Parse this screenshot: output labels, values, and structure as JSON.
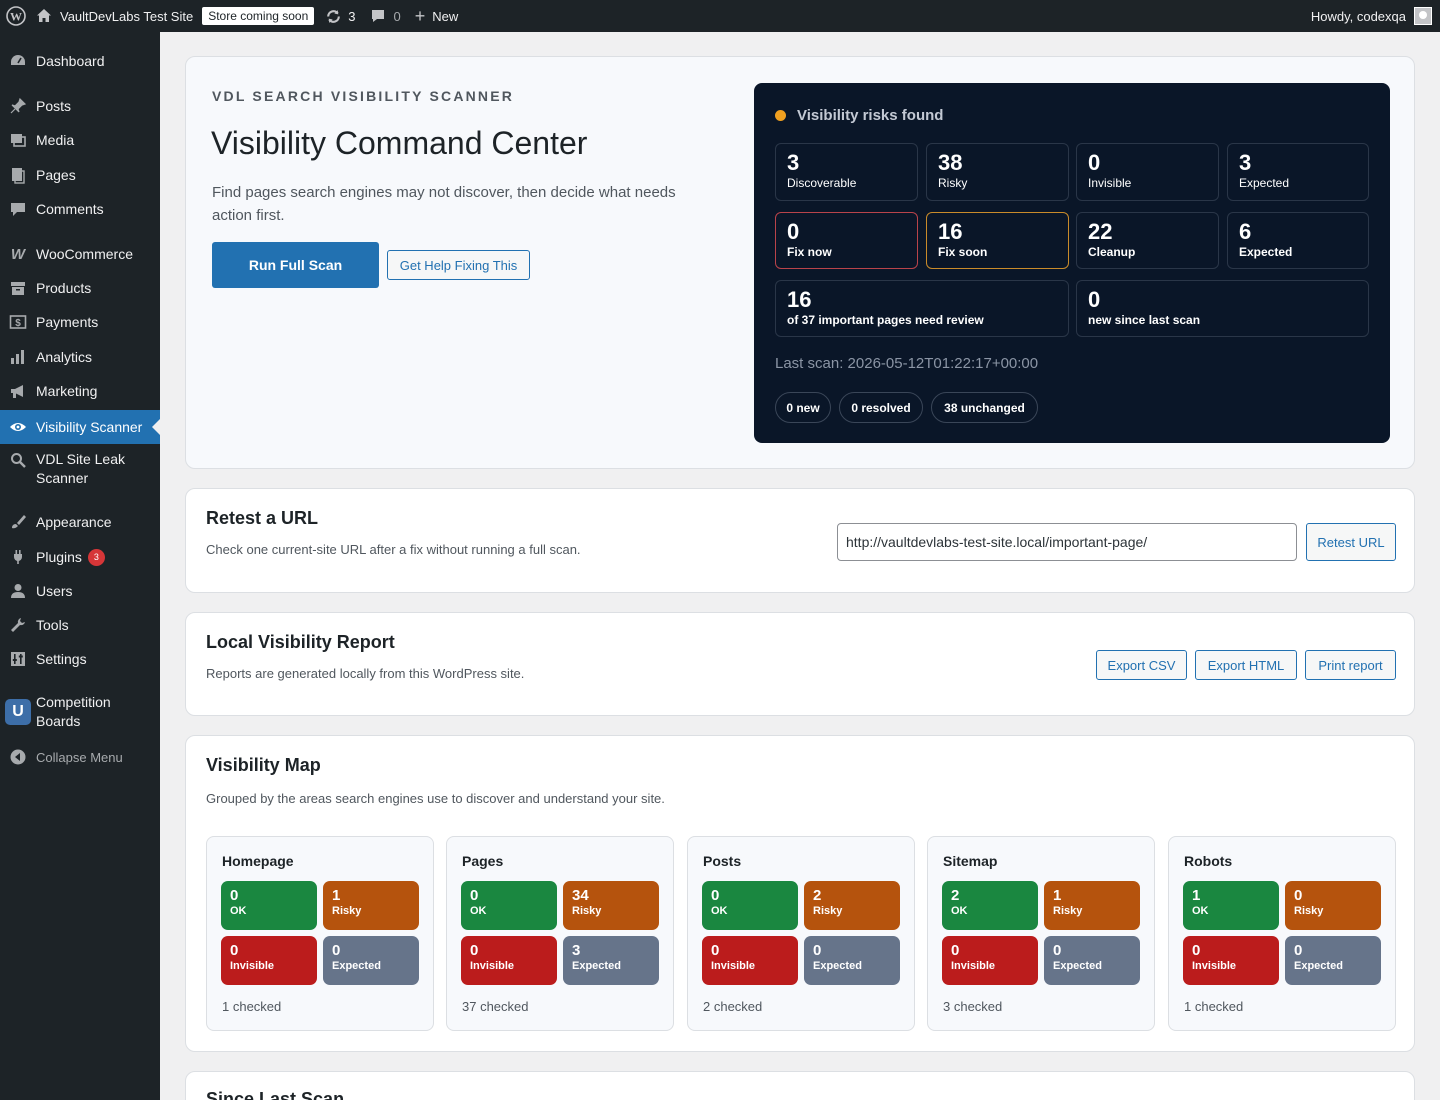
{
  "adminbar": {
    "site_name": "VaultDevLabs Test Site",
    "store_badge": "Store coming soon",
    "updates_count": "3",
    "comments_count": "0",
    "new_label": "New",
    "howdy": "Howdy, codexqa"
  },
  "sidebar": {
    "items": [
      {
        "label": "Dashboard",
        "icon": "dashboard-icon"
      },
      {
        "label": "Posts",
        "icon": "pin-icon"
      },
      {
        "label": "Media",
        "icon": "media-icon"
      },
      {
        "label": "Pages",
        "icon": "page-icon"
      },
      {
        "label": "Comments",
        "icon": "comment-icon"
      },
      {
        "label": "WooCommerce",
        "icon": "woo-icon"
      },
      {
        "label": "Products",
        "icon": "archive-icon"
      },
      {
        "label": "Payments",
        "icon": "dollar-icon"
      },
      {
        "label": "Analytics",
        "icon": "bar-chart-icon"
      },
      {
        "label": "Marketing",
        "icon": "megaphone-icon"
      },
      {
        "label": "Visibility Scanner",
        "icon": "eye-icon"
      },
      {
        "label": "VDL Site Leak Scanner",
        "icon": "search-icon"
      },
      {
        "label": "Appearance",
        "icon": "brush-icon"
      },
      {
        "label": "Plugins",
        "icon": "plug-icon",
        "badge": "3"
      },
      {
        "label": "Users",
        "icon": "user-icon"
      },
      {
        "label": "Tools",
        "icon": "wrench-icon"
      },
      {
        "label": "Settings",
        "icon": "sliders-icon"
      },
      {
        "label": "Competition Boards",
        "icon": "magnet-icon"
      }
    ],
    "collapse_label": "Collapse Menu",
    "active_color": "#2271b1"
  },
  "hero": {
    "eyebrow": "VDL SEARCH VISIBILITY SCANNER",
    "title": "Visibility Command Center",
    "description": "Find pages search engines may not discover, then decide what needs action first.",
    "run_button": "Run Full Scan",
    "help_button": "Get Help Fixing This"
  },
  "panel": {
    "heading": "Visibility risks found",
    "status_color": "#f0a020",
    "row1": [
      {
        "value": "3",
        "label": "Discoverable"
      },
      {
        "value": "38",
        "label": "Risky"
      },
      {
        "value": "0",
        "label": "Invisible"
      },
      {
        "value": "3",
        "label": "Expected"
      }
    ],
    "row2": [
      {
        "value": "0",
        "label": "Fix now"
      },
      {
        "value": "16",
        "label": "Fix soon"
      },
      {
        "value": "22",
        "label": "Cleanup"
      },
      {
        "value": "6",
        "label": "Expected"
      }
    ],
    "row3": [
      {
        "value": "16",
        "label": "of 37 important pages need review"
      },
      {
        "value": "0",
        "label": "new since last scan"
      }
    ],
    "last_scan": "Last scan: 2026-05-12T01:22:17+00:00",
    "pills": [
      "0 new",
      "0 resolved",
      "38 unchanged"
    ]
  },
  "retest": {
    "title": "Retest a URL",
    "description": "Check one current-site URL after a fix without running a full scan.",
    "url_value": "http://vaultdevlabs-test-site.local/important-page/",
    "button": "Retest URL"
  },
  "report": {
    "title": "Local Visibility Report",
    "description": "Reports are generated locally from this WordPress site.",
    "buttons": [
      "Export CSV",
      "Export HTML",
      "Print report"
    ]
  },
  "map": {
    "title": "Visibility Map",
    "description": "Grouped by the areas search engines use to discover and understand your site.",
    "tile_labels": {
      "ok": "OK",
      "risky": "Risky",
      "invisible": "Invisible",
      "expected": "Expected"
    },
    "colors": {
      "ok": "#1a8740",
      "risky": "#b5530d",
      "invisible": "#bb1c1c",
      "expected": "#66748a"
    },
    "groups": [
      {
        "name": "Homepage",
        "ok": "0",
        "risky": "1",
        "invisible": "0",
        "expected": "0",
        "checked": "1 checked"
      },
      {
        "name": "Pages",
        "ok": "0",
        "risky": "34",
        "invisible": "0",
        "expected": "3",
        "checked": "37 checked"
      },
      {
        "name": "Posts",
        "ok": "0",
        "risky": "2",
        "invisible": "0",
        "expected": "0",
        "checked": "2 checked"
      },
      {
        "name": "Sitemap",
        "ok": "2",
        "risky": "1",
        "invisible": "0",
        "expected": "0",
        "checked": "3 checked"
      },
      {
        "name": "Robots",
        "ok": "1",
        "risky": "0",
        "invisible": "0",
        "expected": "0",
        "checked": "1 checked"
      }
    ]
  },
  "since": {
    "title": "Since Last Scan"
  }
}
